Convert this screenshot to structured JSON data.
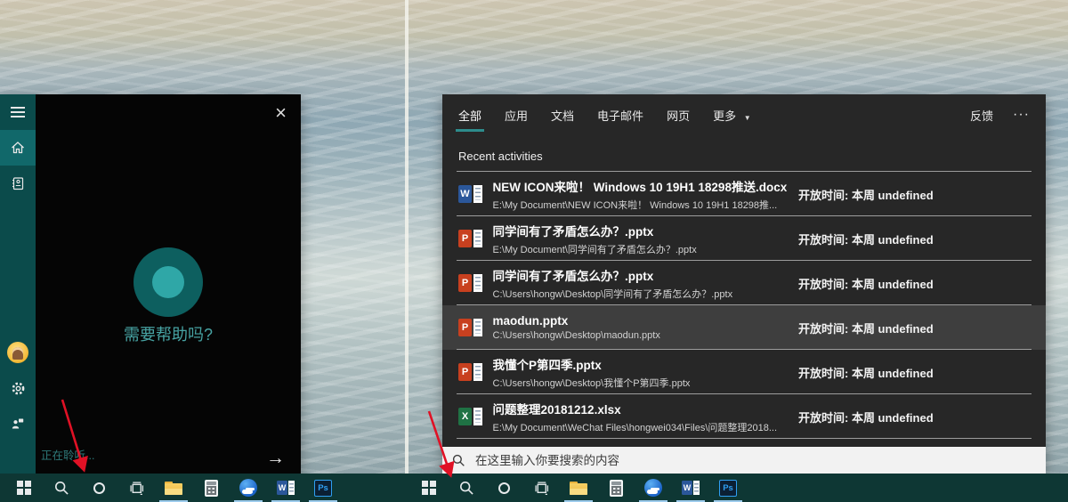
{
  "left_window": {
    "prompt": "需要帮助吗?",
    "listening_status": "正在聆听...",
    "close_glyph": "×",
    "submit_glyph": "→",
    "sidebar_items": [
      "menu",
      "home",
      "notebook",
      "avatar",
      "settings",
      "feedback"
    ]
  },
  "search_window": {
    "tabs": [
      {
        "label": "全部",
        "selected": true
      },
      {
        "label": "应用",
        "selected": false
      },
      {
        "label": "文档",
        "selected": false
      },
      {
        "label": "电子邮件",
        "selected": false
      },
      {
        "label": "网页",
        "selected": false
      },
      {
        "label": "更多",
        "selected": false,
        "has_caret": true
      }
    ],
    "caret_glyph": "▼",
    "feedback_label": "反馈",
    "overflow_glyph": "···",
    "section_title": "Recent activities",
    "items": [
      {
        "app": "word",
        "app_letter": "W",
        "title": "NEW ICON来啦！ Windows 10 19H1 18298推送.docx",
        "path": "E:\\My Document\\NEW ICON来啦！ Windows 10 19H1 18298推...",
        "meta": "开放时间: 本周 undefined",
        "highlighted": false
      },
      {
        "app": "powerpoint",
        "app_letter": "P",
        "title": "同学间有了矛盾怎么办？.pptx",
        "path": "E:\\My Document\\同学间有了矛盾怎么办？.pptx",
        "meta": "开放时间: 本周 undefined",
        "highlighted": false
      },
      {
        "app": "powerpoint",
        "app_letter": "P",
        "title": "同学间有了矛盾怎么办？.pptx",
        "path": "C:\\Users\\hongw\\Desktop\\同学间有了矛盾怎么办？.pptx",
        "meta": "开放时间: 本周 undefined",
        "highlighted": false
      },
      {
        "app": "powerpoint",
        "app_letter": "P",
        "title": "maodun.pptx",
        "path": "C:\\Users\\hongw\\Desktop\\maodun.pptx",
        "meta": "开放时间: 本周 undefined",
        "highlighted": true
      },
      {
        "app": "powerpoint",
        "app_letter": "P",
        "title": "我懂个P第四季.pptx",
        "path": "C:\\Users\\hongw\\Desktop\\我懂个P第四季.pptx",
        "meta": "开放时间: 本周 undefined",
        "highlighted": false
      },
      {
        "app": "excel",
        "app_letter": "X",
        "title": "问题整理20181212.xlsx",
        "path": "E:\\My Document\\WeChat Files\\hongwei034\\Files\\问题整理2018...",
        "meta": "开放时间: 本周 undefined",
        "highlighted": false
      }
    ],
    "search_placeholder": "在这里输入你要搜索的内容"
  },
  "taskbar": {
    "icons": [
      "start",
      "search",
      "cortana",
      "task-view",
      "file-explorer",
      "calculator",
      "quark-browser",
      "word",
      "photoshop"
    ],
    "running_apps": [
      "file-explorer",
      "quark-browser",
      "word",
      "photoshop"
    ],
    "word_letter": "W",
    "ps_label": "Ps"
  },
  "colors": {
    "accent_teal": "#2d8c8c",
    "cortana_circle_outer": "#0d5f5f",
    "cortana_circle_inner": "#2fa7a7",
    "cortana_sidebar": "#0b4b4b",
    "cortana_sidebar_active": "#11686a",
    "taskbar_bg": "#0e3734",
    "panel_bg": "#272727",
    "row_highlight": "#3e3e3e",
    "search_box_bg": "#f2f2f2",
    "word_blue": "#2b579a",
    "powerpoint_red": "#c8401f",
    "excel_green": "#1f7244",
    "annotation_red": "#e01125"
  }
}
